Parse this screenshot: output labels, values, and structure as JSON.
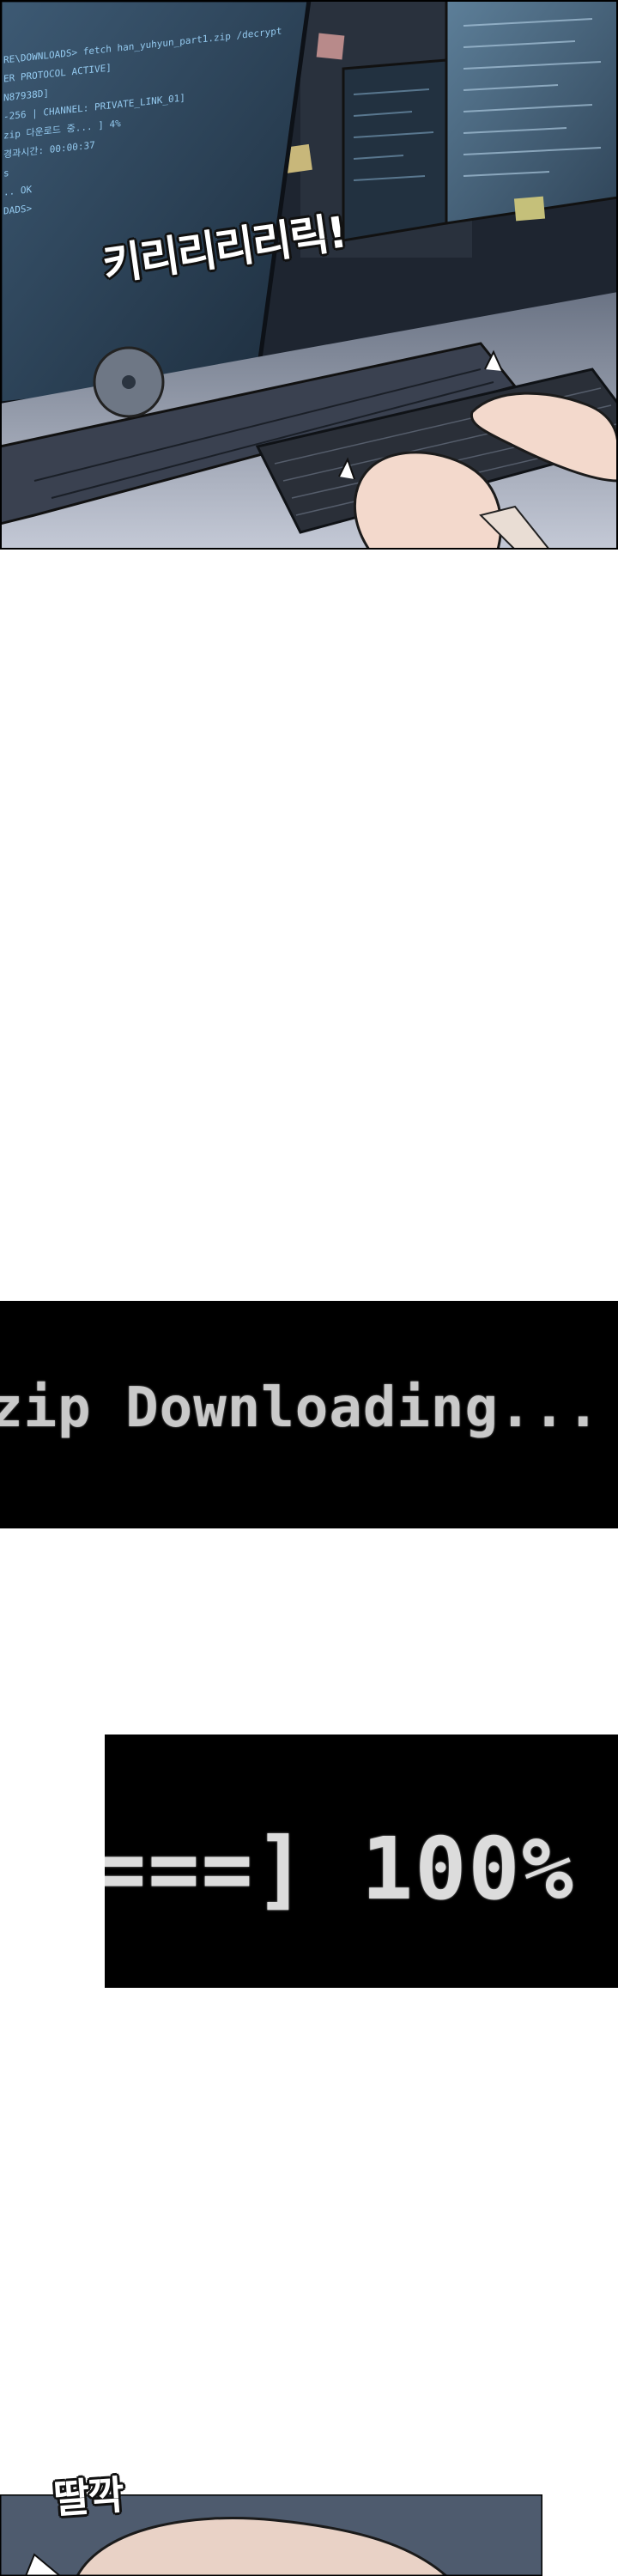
{
  "panel1": {
    "terminal_lines": [
      "RE\\DOWNLOADS> fetch han_yuhyun_part1.zip /decrypt",
      "",
      "ER PROTOCOL ACTIVE]",
      "",
      "N87938D]",
      "-256 | CHANNEL: PRIVATE_LINK_01]",
      "zip 다운로드 중...                ] 4%",
      "",
      "    경과시간: 00:00:37",
      "s",
      "",
      ".. OK",
      "",
      "DADS>"
    ],
    "sfx": "키리리리리릭!"
  },
  "panel2": {
    "text": "zip Downloading..."
  },
  "panel3": {
    "text": "===] 100%"
  },
  "panel4": {
    "sfx": "딸깍"
  },
  "colors": {
    "screen_glow": "#9fd8ff",
    "terminal_text": "#c9c9c9",
    "background": "#ffffff"
  }
}
